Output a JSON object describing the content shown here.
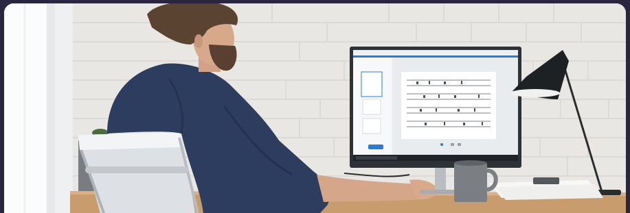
{
  "photo": {
    "subject": "person-at-desk",
    "colors": {
      "wall": "#e8e7e3",
      "shirt": "#2c3d5f",
      "desk": "#c99c6d",
      "monitor_bezel": "#2e3236",
      "screen_accent": "#2b7bd6",
      "lamp": "#1e2124",
      "mug": "#7b7f84",
      "outer_background": "#2a2540"
    }
  }
}
